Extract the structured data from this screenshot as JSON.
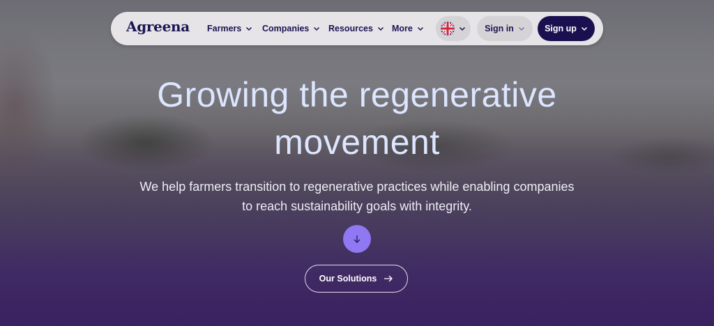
{
  "nav": {
    "logo": "Agreena",
    "items": [
      {
        "label": "Farmers"
      },
      {
        "label": "Companies"
      },
      {
        "label": "Resources"
      },
      {
        "label": "More"
      }
    ],
    "language_icon": "uk-flag-icon",
    "signin_label": "Sign in",
    "signup_label": "Sign up"
  },
  "hero": {
    "title_line1": "Growing the regenerative",
    "title_line2": "movement",
    "subtitle_line1": "We help farmers transition to regenerative practices while enabling companies",
    "subtitle_line2": "to reach sustainability goals with integrity.",
    "scroll_icon": "arrow-down-icon",
    "cta_label": "Our Solutions",
    "cta_icon": "arrow-right-icon"
  },
  "colors": {
    "brand_navy": "#1a1050",
    "accent_purple": "#8f78f2",
    "title_text": "#dde6ff"
  }
}
